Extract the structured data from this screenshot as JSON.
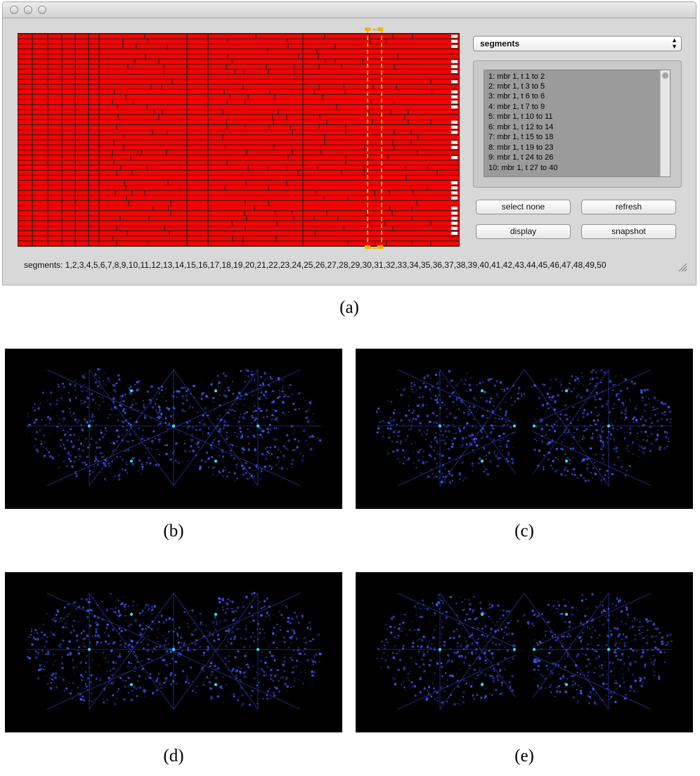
{
  "window": {
    "title_buttons": [
      "close-button",
      "minimize-button",
      "zoom-button"
    ],
    "dropdown_value": "segments",
    "list_items": [
      "1: mbr 1, t 1 to 2",
      "2: mbr 1, t 3 to 5",
      "3: mbr 1, t 6 to 6",
      "4: mbr 1, t 7 to 9",
      "5: mbr 1, t 10 to 11",
      "6: mbr 1, t 12 to 14",
      "7: mbr 1, t 15 to 18",
      "8: mbr 1, t 19 to 23",
      "9: mbr 1, t 24 to 26",
      "10: mbr 1, t 27 to 40"
    ],
    "buttons": {
      "select_none": "select none",
      "refresh": "refresh",
      "display": "display",
      "snapshot": "snapshot"
    },
    "segments_line": "segments: 1,2,3,4,5,6,7,8,9,10,11,12,13,14,15,16,17,18,19,20,21,22,23,24,25,26,27,28,29,30,31,32,33,34,35,36,37,38,39,40,41,42,43,44,45,46,47,48,49,50"
  },
  "colors": {
    "segment_fill": "#ff0000",
    "segment_border": "#222222",
    "selection_outline": "#f0b400",
    "diffraction_spot": "#3a5cff",
    "diffraction_highlight": "#33d6e8"
  },
  "captions": {
    "a": "(a)",
    "b": "(b)",
    "c": "(c)",
    "d": "(d)",
    "e": "(e)"
  },
  "panels": [
    {
      "id": "b",
      "caption": "(b)",
      "gap": "none"
    },
    {
      "id": "c",
      "caption": "(c)",
      "gap": "center"
    },
    {
      "id": "d",
      "caption": "(d)",
      "gap": "none"
    },
    {
      "id": "e",
      "caption": "(e)",
      "gap": "center"
    }
  ]
}
